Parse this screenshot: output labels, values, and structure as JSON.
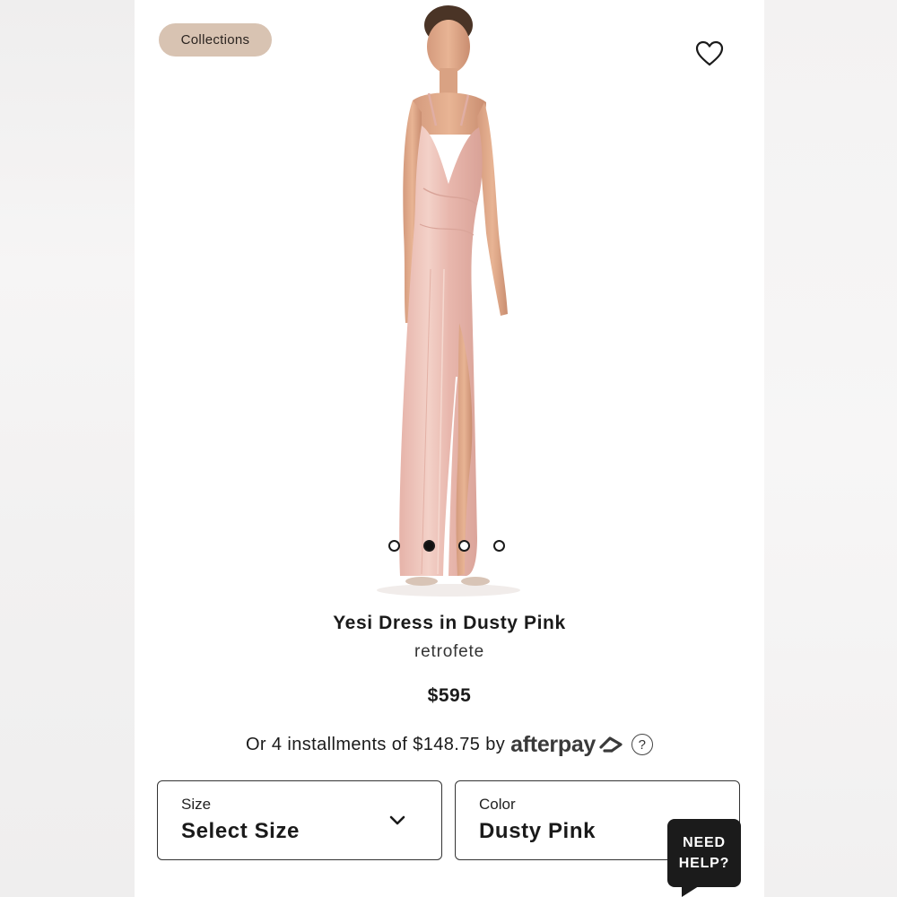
{
  "header": {
    "collections_label": "Collections",
    "wishlist_icon": "heart-icon"
  },
  "gallery": {
    "image_alt": "Yesi Dress in Dusty Pink",
    "dot_count": 4,
    "active_index": 1
  },
  "product": {
    "title": "Yesi Dress in Dusty Pink",
    "brand": "retrofete",
    "price": "$595"
  },
  "payment": {
    "installments_text": "Or 4 installments of $148.75 by",
    "provider": "afterpay",
    "info_label": "?"
  },
  "options": {
    "size": {
      "label": "Size",
      "value": "Select Size"
    },
    "color": {
      "label": "Color",
      "value": "Dusty Pink"
    }
  },
  "help": {
    "line1": "NEED",
    "line2": "HELP?"
  },
  "colors": {
    "pill": "#d8c3b2",
    "dress": "#e8b9b0",
    "help_bg": "#1b1b1b"
  }
}
